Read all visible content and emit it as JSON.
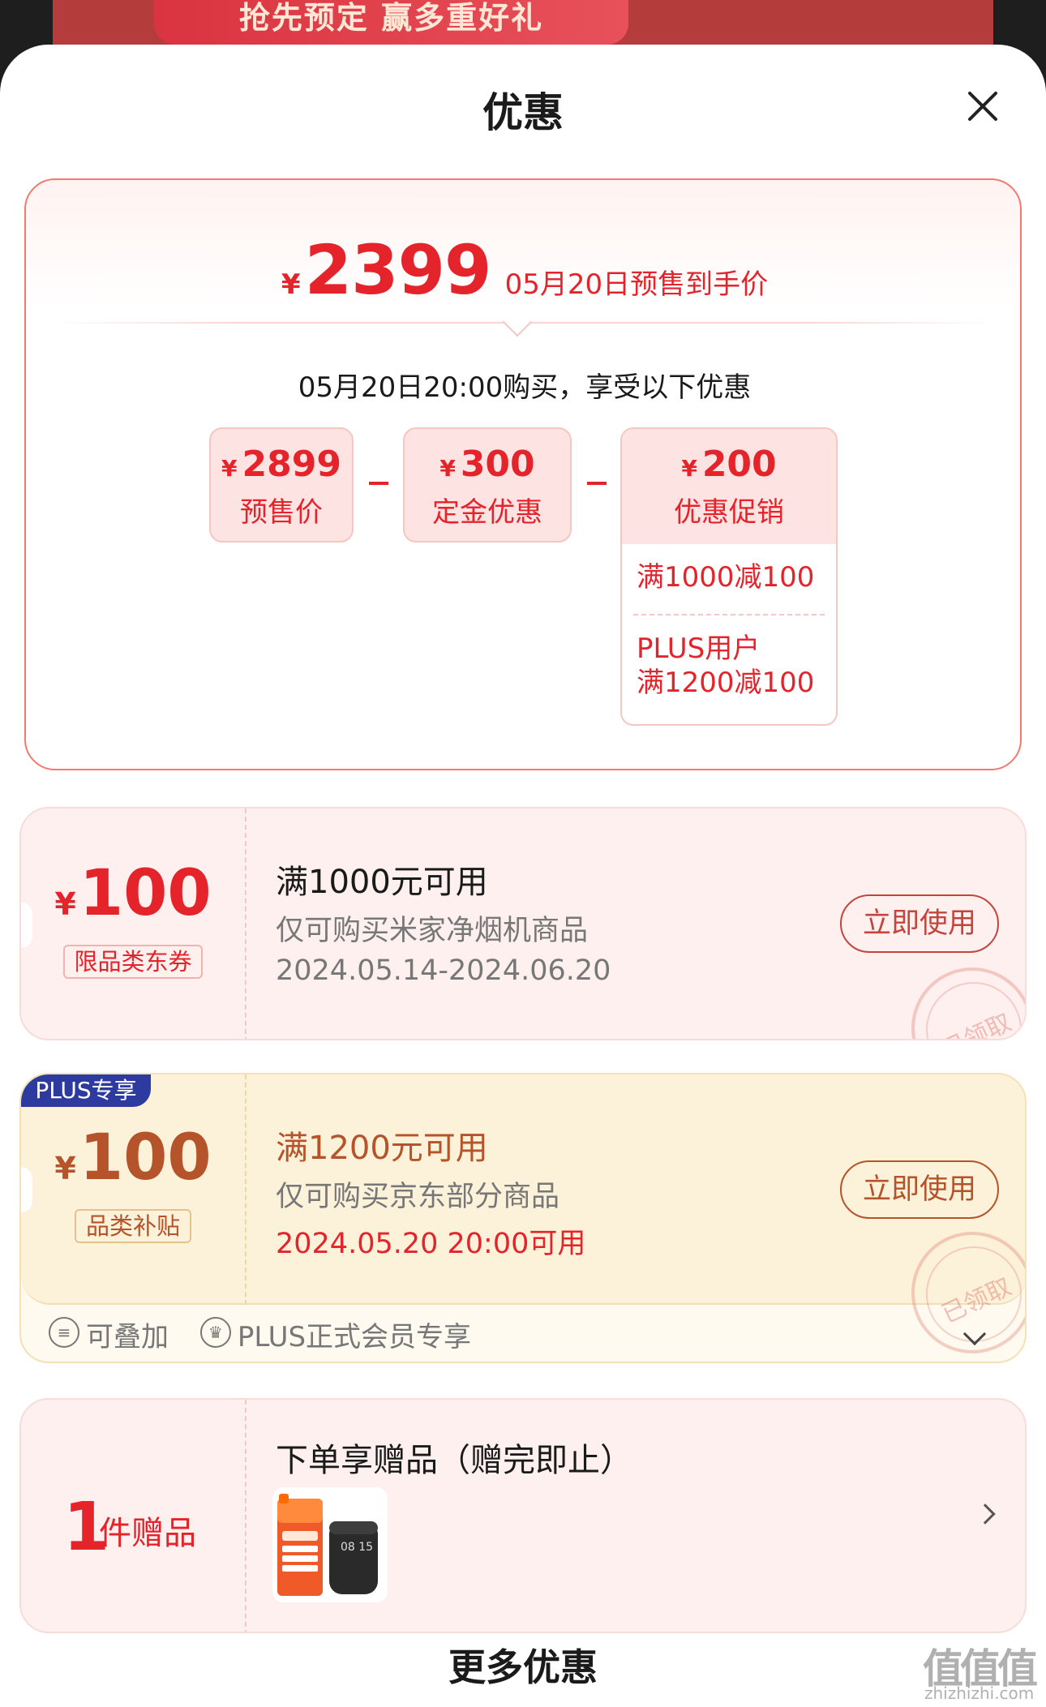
{
  "background": {
    "banner_text": "抢先预定 赢多重好礼"
  },
  "sheet": {
    "title": "优惠"
  },
  "summary": {
    "currency": "¥",
    "final_price": "2399",
    "final_label": "05月20日预售到手价",
    "buy_line": "05月20日20:00购买，享受以下优惠",
    "presale": {
      "amount": "2899",
      "label": "预售价"
    },
    "deposit": {
      "amount": "300",
      "label": "定金优惠"
    },
    "promo": {
      "amount": "200",
      "label": "优惠促销",
      "rule1": "满1000减100",
      "rule2_line1": "PLUS用户",
      "rule2_line2": "满1200减100"
    }
  },
  "coupon1": {
    "currency": "¥",
    "amount": "100",
    "tag": "限品类东券",
    "title": "满1000元可用",
    "desc": "仅可购买米家净烟机商品",
    "date": "2024.05.14-2024.06.20",
    "button": "立即使用",
    "stamp": "已领取"
  },
  "coupon2": {
    "badge": "PLUS专享",
    "currency": "¥",
    "amount": "100",
    "tag": "品类补贴",
    "title": "满1200元可用",
    "desc": "仅可购买京东部分商品",
    "date": "2024.05.20 20:00可用",
    "button": "立即使用",
    "stamp": "已领取",
    "foot_stack": "可叠加",
    "foot_member": "PLUS正式会员专享"
  },
  "gift": {
    "count": "1",
    "count_label": "件赠品",
    "title": "下单享赠品（赠完即止）",
    "clock": "08 15"
  },
  "more_title": "更多优惠",
  "watermark": {
    "mark": "值值值",
    "site": "zhizhizhi.com"
  },
  "colors": {
    "accent_red": "#e5232b",
    "coupon_brown": "#b5542a",
    "plus_blue": "#2d3aa0"
  }
}
